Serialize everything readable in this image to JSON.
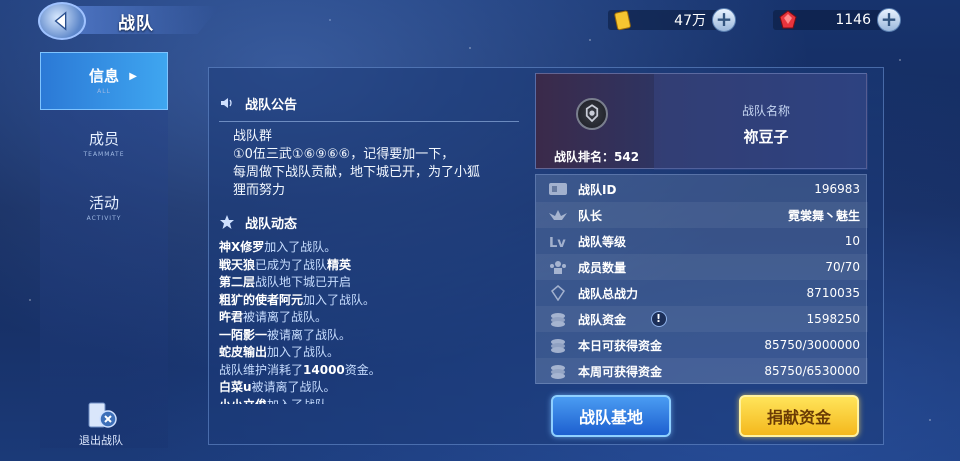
{
  "header": {
    "title": "战队",
    "gold": {
      "value": "47万",
      "icon": "gold-bar-icon"
    },
    "gem": {
      "value": "1146",
      "icon": "red-gem-icon"
    }
  },
  "sidebar": {
    "items": [
      {
        "label": "信息",
        "sub": "ALL",
        "active": true
      },
      {
        "label": "成员",
        "sub": "TEAMMATE",
        "active": false
      },
      {
        "label": "活动",
        "sub": "ACTIVITY",
        "active": false
      }
    ],
    "quit_label": "退出战队"
  },
  "notice": {
    "heading": "战队公告",
    "lines": [
      "战队群",
      "①0伍三武①⑥⑨⑥⑥，记得要加一下，",
      "每周做下战队贡献，地下城已开，为了小狐",
      "狸而努力"
    ]
  },
  "feed": {
    "heading": "战队动态",
    "rows": [
      {
        "name": "神X修罗",
        "action": "加入了战队。",
        "tail": ""
      },
      {
        "name": "戦天狼",
        "action": "已成为了战队",
        "tail": "精英"
      },
      {
        "name": "第二层",
        "action": "战队地下城已开启",
        "tail": ""
      },
      {
        "name": "粗犷的使者阿元",
        "action": "加入了战队。",
        "tail": ""
      },
      {
        "name": "旿君",
        "action": "被请离了战队。",
        "tail": ""
      },
      {
        "name": "一陌影一",
        "action": "被请离了战队。",
        "tail": ""
      },
      {
        "name": "蛇皮输出",
        "action": "加入了战队。",
        "tail": ""
      },
      {
        "name": "",
        "action": "战队维护消耗了",
        "tail": "14000",
        "after": "资金。"
      },
      {
        "name": "白菜u",
        "action": "被请离了战队。",
        "tail": ""
      },
      {
        "name": "小小立俊",
        "action": "加入了战队。",
        "tail": ""
      }
    ]
  },
  "team": {
    "rank_label": "战队排名：542",
    "name_label": "战队名称",
    "name": "祢豆子"
  },
  "stats": [
    {
      "key": "战队ID",
      "value": "196983",
      "icon": "id-card-icon"
    },
    {
      "key": "队长",
      "value": "霓裳舞丶魅生",
      "icon": "captain-wings-icon",
      "bold": true
    },
    {
      "key": "战队等级",
      "value": "10",
      "icon": "level-icon"
    },
    {
      "key": "成员数量",
      "value": "70/70",
      "icon": "members-icon"
    },
    {
      "key": "战队总战力",
      "value": "8710035",
      "icon": "power-icon"
    },
    {
      "key": "战队资金",
      "value": "1598250",
      "icon": "coins-icon",
      "warn": "!"
    },
    {
      "key": "本日可获得资金",
      "value": "85750/3000000",
      "icon": "coins-icon"
    },
    {
      "key": "本周可获得资金",
      "value": "85750/6530000",
      "icon": "coins-icon"
    }
  ],
  "buttons": {
    "base": "战队基地",
    "donate": "捐献资金"
  }
}
